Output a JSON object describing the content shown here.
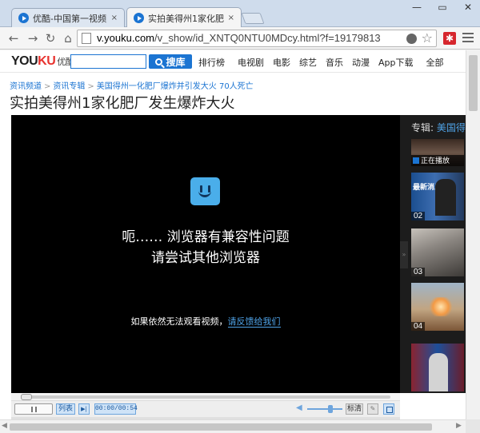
{
  "browser": {
    "tabs": [
      {
        "label": "优酷-中国第一视频网站,提",
        "active": false
      },
      {
        "label": "实拍美得州1家化肥厂发生爆",
        "active": true
      }
    ],
    "url": {
      "prefix": "v.youku.com",
      "path": "/v_show/id_XNTQ0NTU0MDcy.html?f=19179813"
    },
    "close_glyph": "×"
  },
  "site": {
    "logo": {
      "part1": "YOU",
      "part2": "KU",
      "cn": "优酷"
    },
    "search_input": "",
    "search_button": "搜库",
    "nav": [
      "排行榜",
      "电视剧",
      "电影",
      "综艺",
      "音乐",
      "动漫",
      "App下载",
      "全部"
    ]
  },
  "breadcrumb": [
    "资讯频道",
    "资讯专辑",
    "美国得州一化肥厂爆炸并引发大火 70人死亡"
  ],
  "breadcrumb_sep": ">",
  "page_title": "实拍美得州1家化肥厂发生爆炸大火",
  "player": {
    "error_line1": "呃…… 浏览器有兼容性问题",
    "error_line2": "请尝试其他浏览器",
    "hint_text": "如果依然无法观看视频，",
    "hint_link": "请反馈给我们"
  },
  "sidebar": {
    "label": "专辑:",
    "label_highlight": "美国得",
    "now_playing": "正在播放",
    "news_badge": "最新消息",
    "numbers": [
      "02",
      "03",
      "04"
    ]
  },
  "controls": {
    "list": "列表",
    "time": "00:00/00:54",
    "quality": "标清"
  },
  "colors": {
    "accent": "#1b74d2",
    "logo_red": "#e8322e",
    "smiley": "#4aaeea"
  }
}
